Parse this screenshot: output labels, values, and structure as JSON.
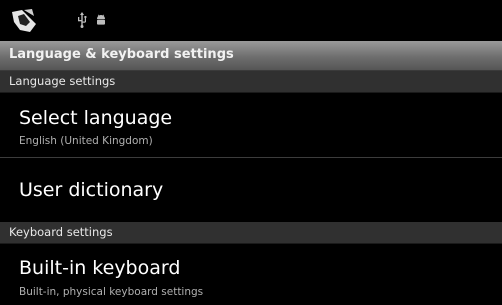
{
  "status_bar": {
    "icons": [
      "app-icon",
      "usb-icon",
      "android-icon"
    ]
  },
  "title_bar": {
    "title": "Language & keyboard settings"
  },
  "sections": [
    {
      "header": "Language settings",
      "items": [
        {
          "title": "Select language",
          "summary": "English (United Kingdom)"
        },
        {
          "title": "User dictionary",
          "summary": ""
        }
      ]
    },
    {
      "header": "Keyboard settings",
      "items": [
        {
          "title": "Built-in keyboard",
          "summary": "Built-in, physical keyboard settings"
        }
      ]
    }
  ],
  "colors": {
    "background": "#000000",
    "title_bar": "#7a7a7a",
    "section_header": "#303030",
    "summary_text": "#b0b0b0"
  }
}
